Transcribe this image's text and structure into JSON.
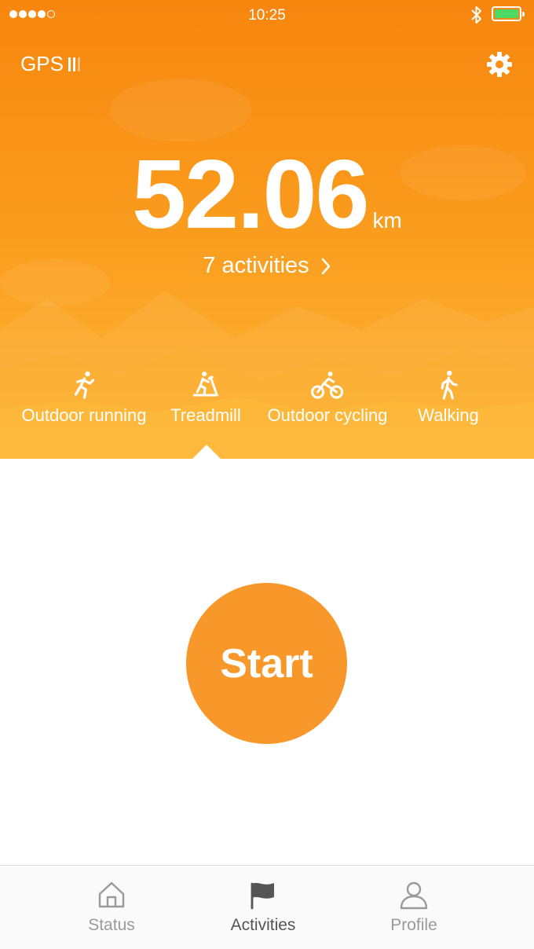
{
  "status_bar": {
    "time": "10:25",
    "battery_level": 1.0,
    "battery_color": "#4cd964",
    "signal_bars_filled": 4,
    "signal_bars_total": 5,
    "bluetooth_icon": "bluetooth-icon"
  },
  "header": {
    "gps_label": "GPS",
    "gps_signal_icon": "gps-signal-bars-icon",
    "settings_icon": "gear-icon"
  },
  "summary": {
    "distance_value": "52.06",
    "distance_unit": "km",
    "activities_count_label": "7 activities",
    "activities_chevron": "›"
  },
  "activity_types": [
    {
      "label": "Outdoor running",
      "icon": "running-icon"
    },
    {
      "label": "Treadmill",
      "icon": "treadmill-icon",
      "selected": true
    },
    {
      "label": "Outdoor cycling",
      "icon": "cycling-icon"
    },
    {
      "label": "Walking",
      "icon": "walking-icon"
    }
  ],
  "start_button": {
    "label": "Start"
  },
  "tab_bar": [
    {
      "label": "Status",
      "icon": "home-icon"
    },
    {
      "label": "Activities",
      "icon": "flag-icon",
      "active": true
    },
    {
      "label": "Profile",
      "icon": "person-icon"
    }
  ],
  "colors": {
    "accent": "#f8982b",
    "hero_top": "#f7860f",
    "hero_bottom": "#fdb534"
  }
}
